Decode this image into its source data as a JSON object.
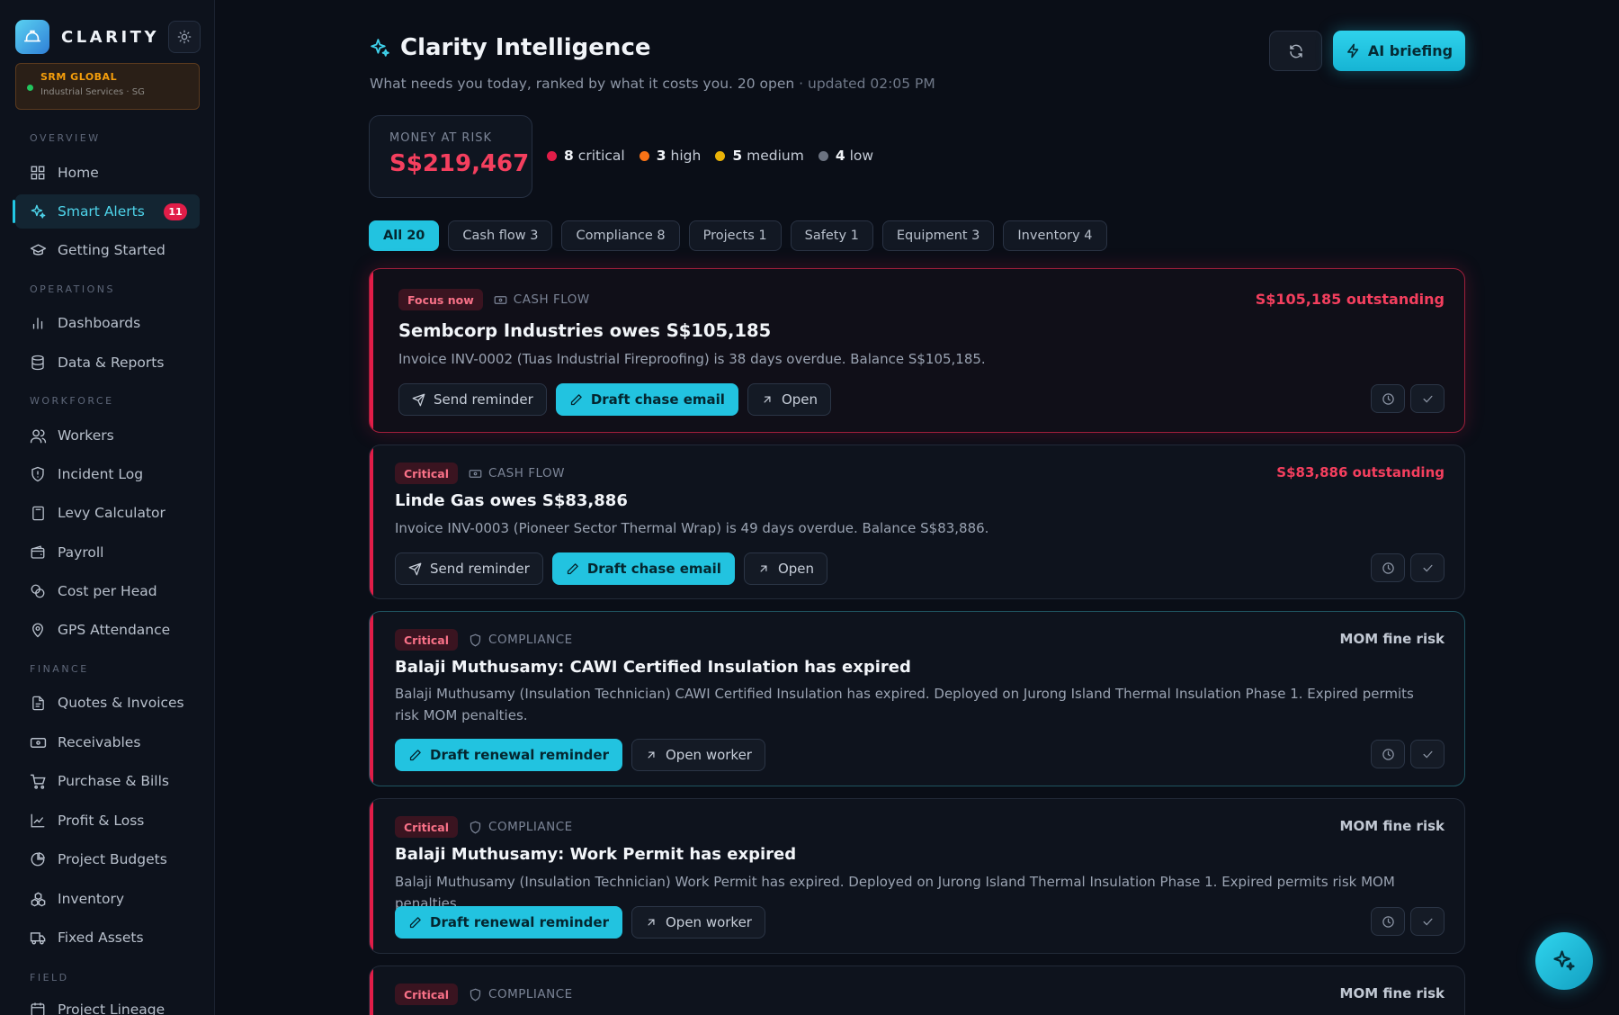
{
  "brand": {
    "name": "CLARITY"
  },
  "org": {
    "name": "SRM GLOBAL",
    "sub": "Industrial Services · SG"
  },
  "sidebar": {
    "sections": {
      "overview": "OVERVIEW",
      "operations": "OPERATIONS",
      "workforce": "WORKFORCE",
      "finance": "FINANCE",
      "field": "FIELD"
    },
    "items": {
      "home": "Home",
      "smart_alerts": "Smart Alerts",
      "smart_alerts_badge": "11",
      "getting_started": "Getting Started",
      "dashboards": "Dashboards",
      "data_reports": "Data & Reports",
      "workers": "Workers",
      "incident_log": "Incident Log",
      "levy_calculator": "Levy Calculator",
      "payroll": "Payroll",
      "cost_per_head": "Cost per Head",
      "gps_attendance": "GPS Attendance",
      "quotes_invoices": "Quotes & Invoices",
      "receivables": "Receivables",
      "purchase_bills": "Purchase & Bills",
      "profit_loss": "Profit & Loss",
      "project_budgets": "Project Budgets",
      "inventory": "Inventory",
      "fixed_assets": "Fixed Assets",
      "project_lineage": "Project Lineage"
    }
  },
  "header": {
    "title": "Clarity Intelligence",
    "subtitle": "What needs you today, ranked by what it costs you. 20 open",
    "updated": " · updated 02:05 PM",
    "briefing_label": "AI briefing"
  },
  "risk": {
    "label": "MONEY AT RISK",
    "value": "S$219,467"
  },
  "severity": [
    {
      "count": "8",
      "label": "critical",
      "color": "#e11d48"
    },
    {
      "count": "3",
      "label": "high",
      "color": "#f97316"
    },
    {
      "count": "5",
      "label": "medium",
      "color": "#eab308"
    },
    {
      "count": "4",
      "label": "low",
      "color": "#6b7280"
    }
  ],
  "filters": [
    "All 20",
    "Cash flow 3",
    "Compliance 8",
    "Projects 1",
    "Safety 1",
    "Equipment 3",
    "Inventory 4"
  ],
  "alerts": [
    {
      "tag": "Focus now",
      "category": "CASH FLOW",
      "impact": "S$105,185 outstanding",
      "title": "Sembcorp Industries owes S$105,185",
      "desc": "Invoice INV-0002 (Tuas Industrial Fireproofing) is 38 days overdue. Balance S$105,185.",
      "actions": [
        "Send reminder",
        "Draft chase email",
        "Open"
      ]
    },
    {
      "tag": "Critical",
      "category": "CASH FLOW",
      "impact": "S$83,886 outstanding",
      "title": "Linde Gas owes S$83,886",
      "desc": "Invoice INV-0003 (Pioneer Sector Thermal Wrap) is 49 days overdue. Balance S$83,886.",
      "actions": [
        "Send reminder",
        "Draft chase email",
        "Open"
      ]
    },
    {
      "tag": "Critical",
      "category": "COMPLIANCE",
      "impact": "MOM fine risk",
      "title": "Balaji Muthusamy: CAWI Certified Insulation has expired",
      "desc": "Balaji Muthusamy (Insulation Technician) CAWI Certified Insulation has expired. Deployed on Jurong Island Thermal Insulation Phase 1. Expired permits risk MOM penalties.",
      "actions": [
        "Draft renewal reminder",
        "Open worker"
      ]
    },
    {
      "tag": "Critical",
      "category": "COMPLIANCE",
      "impact": "MOM fine risk",
      "title": "Balaji Muthusamy: Work Permit has expired",
      "desc": "Balaji Muthusamy (Insulation Technician) Work Permit has expired. Deployed on Jurong Island Thermal Insulation Phase 1. Expired permits risk MOM penalties.",
      "actions": [
        "Draft renewal reminder",
        "Open worker"
      ]
    },
    {
      "tag": "Critical",
      "category": "COMPLIANCE",
      "impact": "MOM fine risk"
    }
  ]
}
